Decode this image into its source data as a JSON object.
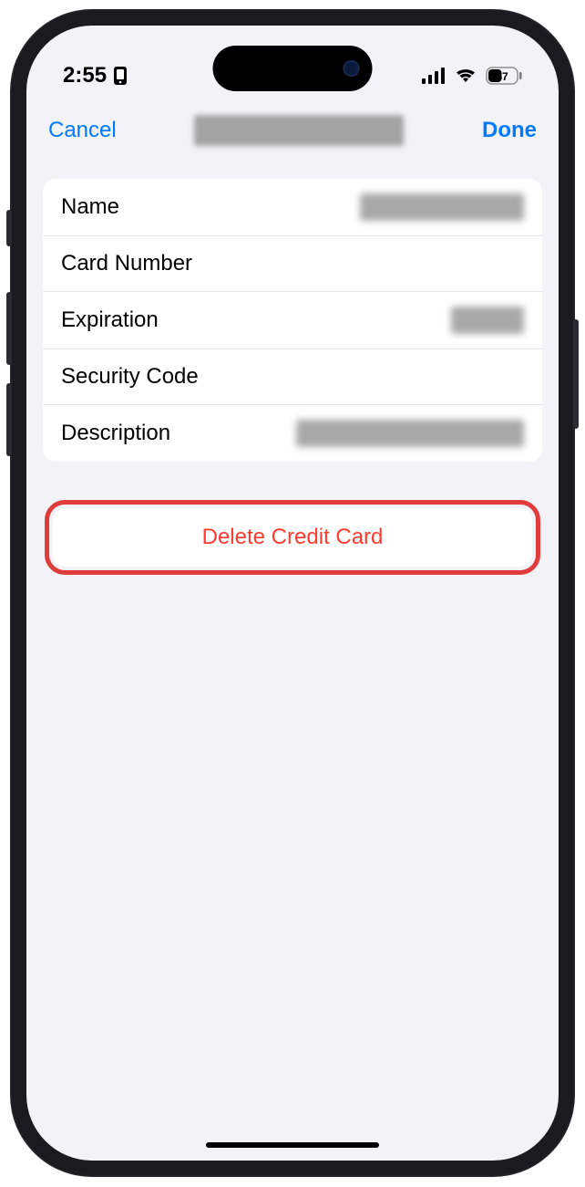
{
  "status": {
    "time": "2:55",
    "battery_level": "47"
  },
  "nav": {
    "cancel": "Cancel",
    "done": "Done"
  },
  "fields": {
    "name": "Name",
    "card_number": "Card Number",
    "expiration": "Expiration",
    "security_code": "Security Code",
    "description": "Description"
  },
  "delete": {
    "label": "Delete Credit Card"
  }
}
